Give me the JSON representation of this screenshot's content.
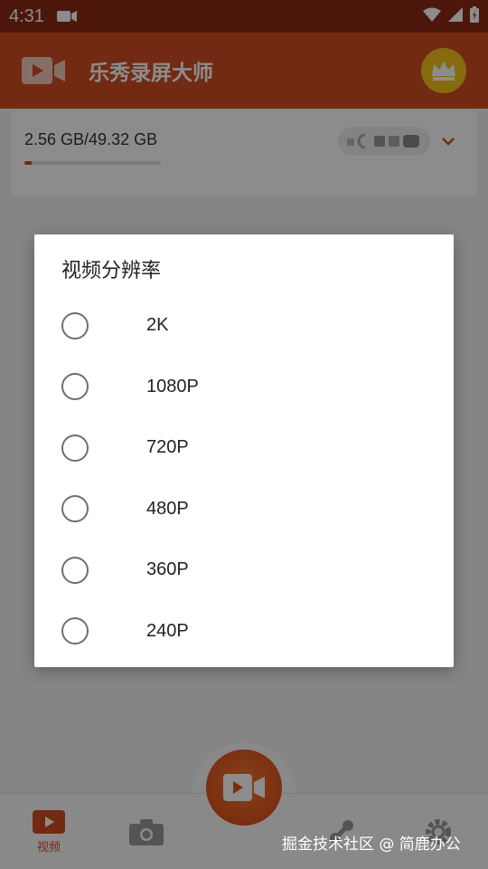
{
  "status_bar": {
    "time": "4:31"
  },
  "app_bar": {
    "title": "乐秀录屏大师"
  },
  "storage": {
    "text": "2.56 GB/49.32 GB",
    "used_fraction": 0.052
  },
  "bottom_nav": {
    "video_label": "视频"
  },
  "watermark": "掘金技术社区 @ 简鹿办公",
  "dialog": {
    "title": "视频分辨率",
    "options": [
      "2K",
      "1080P",
      "720P",
      "480P",
      "360P",
      "240P"
    ]
  },
  "colors": {
    "accent": "#d14e24",
    "crown": "#f3c41a"
  }
}
